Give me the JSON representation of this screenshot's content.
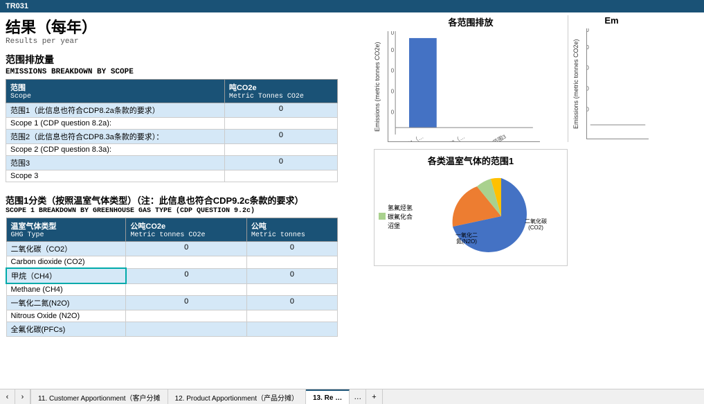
{
  "topBar": {
    "label": "TR031"
  },
  "pageTitle": {
    "cn": "结果（每年）",
    "en": "Results per year"
  },
  "emissionsBreakdown": {
    "titleCn": "范围排放量",
    "titleEn": "EMISSIONS BREAKDOWN BY SCOPE",
    "headers": {
      "col1Cn": "范围",
      "col1En": "Scope",
      "col2Cn": "吨CO2e",
      "col2En": "Metric Tonnes CO2e"
    },
    "rows": [
      {
        "labelCn": "范围1（此信息也符合CDP8.2a条款的要求）",
        "labelEn": "Scope 1 (CDP question 8.2a):",
        "value": "0"
      },
      {
        "labelCn": "范围2（此信息也符合CDP8.3a条款的要求）：",
        "labelEn": "Scope 2 (CDP question 8.3a):",
        "value": "0"
      },
      {
        "labelCn": "范围3",
        "labelEn": "Scope 3",
        "value": "0"
      }
    ]
  },
  "ghgBreakdown": {
    "titleCn": "范围1分类（按照温室气体类型）（注：此信息也符合CDP9.2c条款的要求）",
    "titleEn": "SCOPE 1 BREAKDOWN BY GREENHOUSE GAS TYPE (CDP QUESTION 9.2c)",
    "headers": {
      "col1Cn": "温室气体类型",
      "col1En": "GHG Type",
      "col2Cn": "公吨CO2e",
      "col2En": "Metric tonnes CO2e",
      "col3Cn": "公吨",
      "col3En": "Metric tonnes"
    },
    "rows": [
      {
        "labelCn": "二氧化碳（CO2）",
        "labelEn": "Carbon dioxide (CO2)",
        "value1": "0",
        "value2": "0"
      },
      {
        "labelCn": "甲烷（CH4）",
        "labelEn": "Methane (CH4)",
        "value1": "0",
        "value2": "0",
        "highlight": true
      },
      {
        "labelCn": "一氧化二氮(N2O)",
        "labelEn": "Nitrous Oxide (N2O)",
        "value1": "0",
        "value2": "0"
      },
      {
        "labelCn": "全氟化碳(PFCs)",
        "labelEn": "",
        "value1": "",
        "value2": ""
      }
    ]
  },
  "barChart1": {
    "title": "各范围排放",
    "yLabel": "Emissions (metric tonnes CO2e)",
    "xLabels": [
      "范围1（…",
      "范围2（…",
      "范围3"
    ],
    "values": [
      8,
      0,
      0
    ],
    "maxValue": 10
  },
  "barChart2": {
    "title": "Em",
    "yLabel": "Emissions (metric tonnes CO2e)",
    "values": [
      0,
      0,
      0
    ],
    "maxValue": 10
  },
  "pieChart": {
    "title": "各类温室气体的范围1",
    "segments": [
      {
        "label": "二氧化碳\n(CO2)",
        "color": "#4472C4",
        "percent": 60
      },
      {
        "label": "一氧化二\n氮(N2O)",
        "color": "#ED7D31",
        "percent": 20
      },
      {
        "label": "氢氟烃\n(HFCs)",
        "color": "#A9D18E",
        "percent": 10
      },
      {
        "label": "碳氟化合\n物(PFCs)",
        "color": "#FFC000",
        "percent": 5
      },
      {
        "label": "沼泽",
        "color": "#5B9BD5",
        "percent": 5
      }
    ],
    "legendNote": "氢氟烃氢\n碳氟化合\n沼堡"
  },
  "bottomNav": {
    "tabs": [
      {
        "label": "11. Customer Apportionment（客户分摊",
        "active": false
      },
      {
        "label": "12. Product Apportionment（产品分摊）",
        "active": false
      },
      {
        "label": "13. Re …",
        "active": true
      }
    ],
    "plusLabel": "+"
  }
}
